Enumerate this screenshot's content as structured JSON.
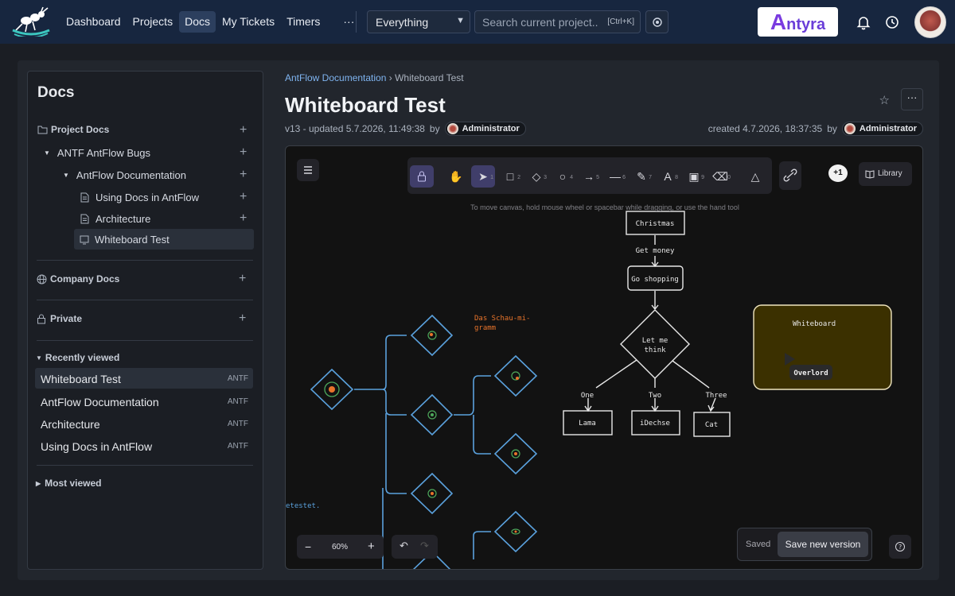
{
  "topbar": {
    "nav": [
      "Dashboard",
      "Projects",
      "Docs",
      "My Tickets",
      "Timers",
      "···"
    ],
    "active_nav": "Docs",
    "scope_select": "Everything",
    "search_placeholder": "Search current project..",
    "search_shortcut": "[Ctrl+K]",
    "brand": "Antyra",
    "brand_initial": "A",
    "brand_rest": "ntyra"
  },
  "sidebar": {
    "title": "Docs",
    "project_docs": "Project Docs",
    "tree": {
      "bugs": "ANTF AntFlow Bugs",
      "documentation": "AntFlow Documentation",
      "using_docs": "Using Docs in AntFlow",
      "architecture": "Architecture",
      "whiteboard": "Whiteboard Test"
    },
    "company_docs": "Company Docs",
    "private": "Private",
    "recently_viewed": "Recently viewed",
    "recent": [
      {
        "title": "Whiteboard Test",
        "tag": "ANTF"
      },
      {
        "title": "AntFlow Documentation",
        "tag": "ANTF"
      },
      {
        "title": "Architecture",
        "tag": "ANTF"
      },
      {
        "title": "Using Docs in AntFlow",
        "tag": "ANTF"
      }
    ],
    "most_viewed": "Most viewed"
  },
  "doc": {
    "breadcrumb_parent": "AntFlow Documentation",
    "breadcrumb_sep": "›",
    "breadcrumb_current": "Whiteboard Test",
    "title": "Whiteboard Test",
    "updated": "v13 - updated 5.7.2026, 11:49:38",
    "created": "created 4.7.2026, 18:37:35",
    "by": "by",
    "author": "Administrator"
  },
  "whiteboard": {
    "hint": "To move canvas, hold mouse wheel or spacebar while dragging, or use the hand tool",
    "library": "Library",
    "collaborators": "+1",
    "zoom": "60%",
    "saved": "Saved",
    "save_new_version": "Save new version",
    "tool_numbers": [
      "1",
      "2",
      "3",
      "4",
      "5",
      "6",
      "7",
      "8",
      "9",
      "0"
    ],
    "flow": {
      "christmas": "Christmas",
      "get_money": "Get money",
      "go_shopping": "Go shopping",
      "let_me": "Let me",
      "think": "think",
      "one": "One",
      "two": "Two",
      "three": "Three",
      "lama": "Lama",
      "dechse": "iDechse",
      "cat": "Cat",
      "embed_title": "Whiteboard",
      "overlord": "Overlord",
      "schau_1": "Das Schau-mi-",
      "schau_2": "gramm",
      "etestet": "etestet."
    }
  }
}
